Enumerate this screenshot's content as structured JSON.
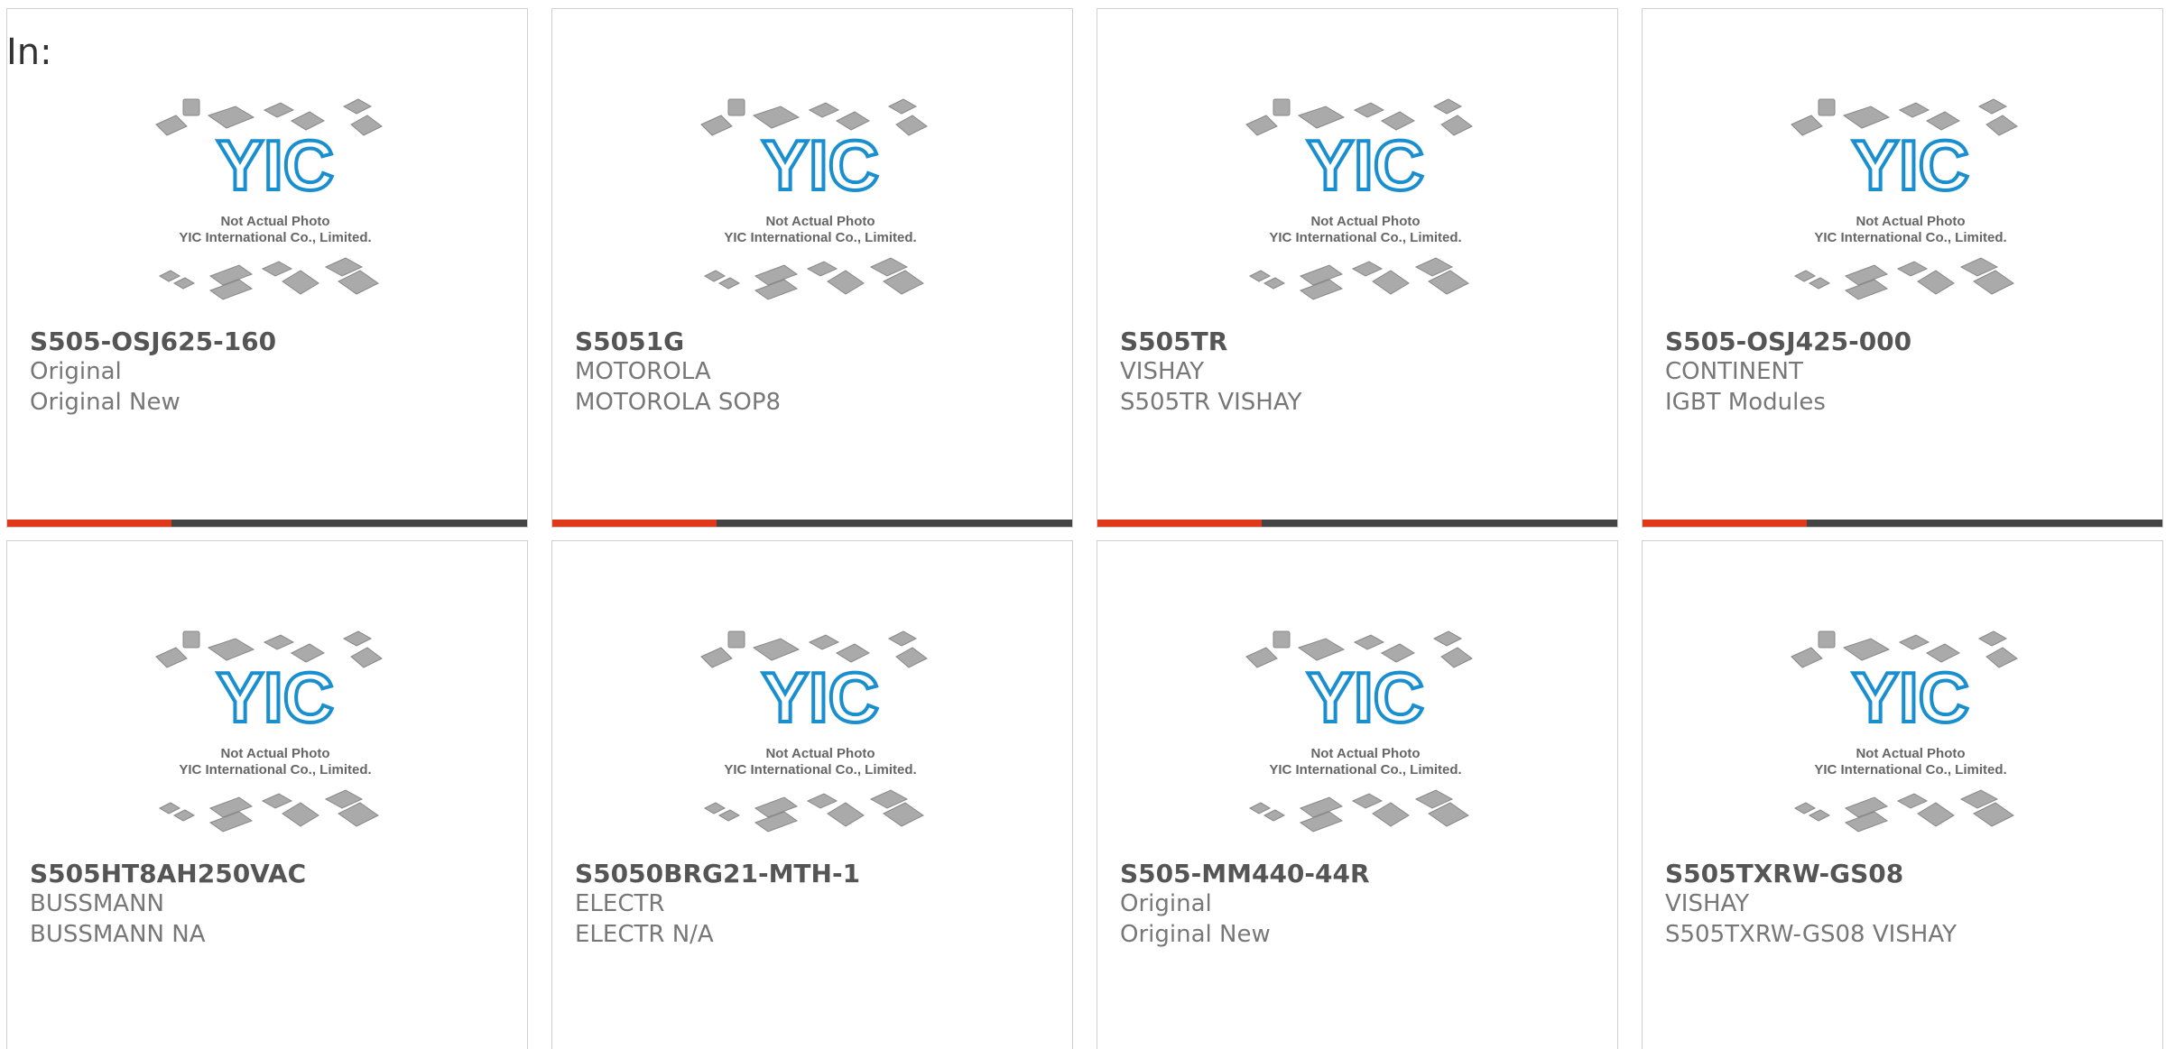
{
  "header": {
    "in_label": "In:"
  },
  "thumbnail": {
    "logo_text": "YIC",
    "caption_line1": "Not Actual Photo",
    "caption_line2": "YIC International Co., Limited."
  },
  "colors": {
    "accent": "#e0391a",
    "bar": "#444444",
    "logo": "#1a8fd0"
  },
  "products": [
    {
      "part": "S505-OSJ625-160",
      "maker": "Original",
      "desc": "Original New"
    },
    {
      "part": "S5051G",
      "maker": "MOTOROLA",
      "desc": "MOTOROLA SOP8"
    },
    {
      "part": "S505TR",
      "maker": "VISHAY",
      "desc": "S505TR VISHAY"
    },
    {
      "part": "S505-OSJ425-000",
      "maker": "CONTINENT",
      "desc": "IGBT Modules"
    },
    {
      "part": "S505HT8AH250VAC",
      "maker": "BUSSMANN",
      "desc": "BUSSMANN NA"
    },
    {
      "part": "S5050BRG21-MTH-1",
      "maker": "ELECTR",
      "desc": "ELECTR N/A"
    },
    {
      "part": "S505-MM440-44R",
      "maker": "Original",
      "desc": "Original New"
    },
    {
      "part": "S505TXRW-GS08",
      "maker": "VISHAY",
      "desc": "S505TXRW-GS08 VISHAY"
    }
  ]
}
